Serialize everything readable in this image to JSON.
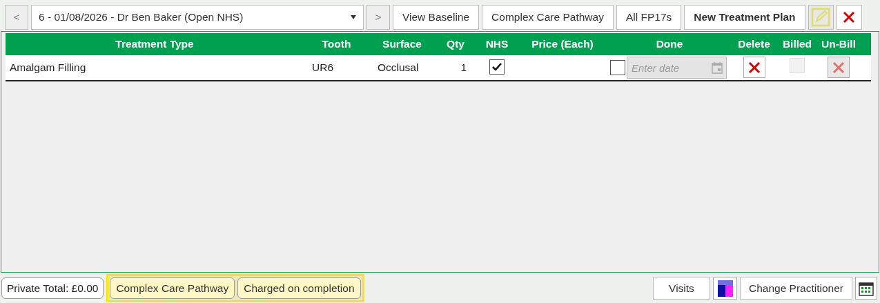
{
  "toolbar": {
    "prev_label": "<",
    "course_select": "6 - 01/08/2026 - Dr Ben Baker (Open NHS)",
    "next_label": ">",
    "buttons": [
      {
        "label": "View Baseline",
        "bold": false
      },
      {
        "label": "Complex Care Pathway",
        "bold": false
      },
      {
        "label": "All FP17s",
        "bold": false
      },
      {
        "label": "New Treatment Plan",
        "bold": true
      }
    ],
    "edit_disabled": true
  },
  "table": {
    "columns": [
      {
        "label": "Treatment Type"
      },
      {
        "label": "Tooth"
      },
      {
        "label": "Surface"
      },
      {
        "label": "Qty"
      },
      {
        "label": "NHS"
      },
      {
        "label": "Price (Each)"
      },
      {
        "label": "Done"
      },
      {
        "label": "Delete"
      },
      {
        "label": "Billed"
      },
      {
        "label": "Un-Bill"
      }
    ],
    "rows": [
      {
        "treatment_type": "Amalgam Filling",
        "tooth": "UR6",
        "surface": "Occlusal",
        "qty": "1",
        "nhs": true,
        "done": false,
        "date_placeholder": "Enter date",
        "billed": false,
        "billed_disabled": true,
        "unbill_disabled": true
      }
    ]
  },
  "footer": {
    "private_total": "Private Total: £0.00",
    "flags": [
      {
        "label": "Complex Care Pathway"
      },
      {
        "label": "Charged on completion"
      }
    ],
    "highlighted": true,
    "buttons": [
      {
        "kind": "text",
        "label": "Visits"
      },
      {
        "kind": "cic"
      },
      {
        "kind": "text",
        "label": "Change Practitioner"
      },
      {
        "kind": "calendar"
      }
    ]
  }
}
